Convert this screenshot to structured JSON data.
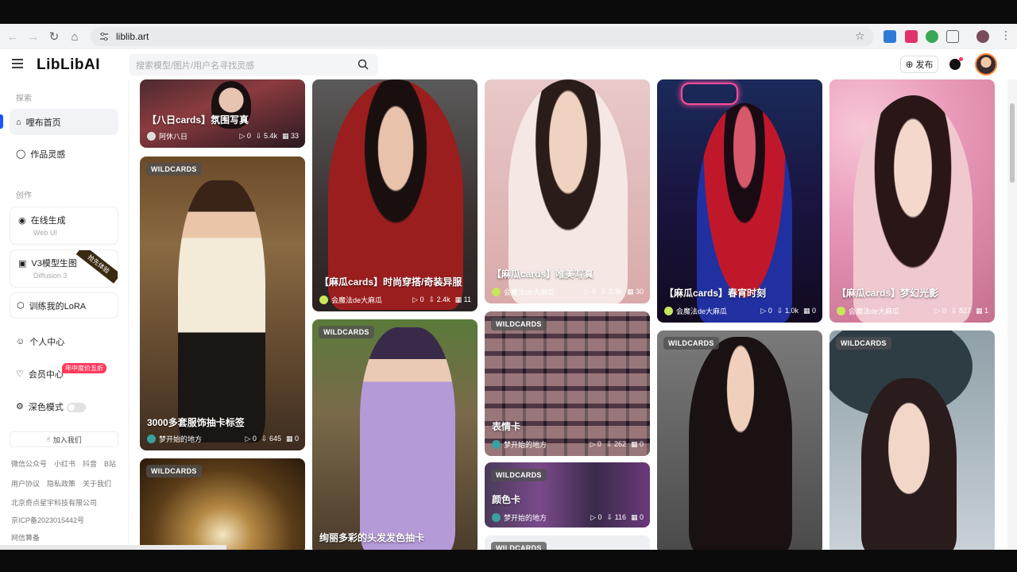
{
  "browser": {
    "url": "liblib.art"
  },
  "header": {
    "logo": "LibLibAI",
    "search_placeholder": "搜索模型/图片/用户名寻找灵感",
    "publish_label": "发布"
  },
  "sidebar": {
    "section_explore": "探索",
    "section_create": "创作",
    "home": "哩布首页",
    "inspiration": "作品灵感",
    "online_gen": {
      "title": "在线生成",
      "sub": "Web UI"
    },
    "v3_gen": {
      "title": "V3模型生图",
      "sub": "Diffusion 3",
      "ribbon": "抢先体验"
    },
    "train_lora": "训练我的LoRA",
    "personal": "个人中心",
    "member": "会员中心",
    "member_badge": "年中度价五折",
    "dark_mode": "深色模式",
    "join_us": "加入我们",
    "footer_links": [
      "微信公众号",
      "小红书",
      "抖音",
      "B站"
    ],
    "footer_links2": [
      "用户协议",
      "隐私政策",
      "关于我们"
    ],
    "company": "北京奇点星宇科技有限公司",
    "icp": "京ICP备2023015442号",
    "net": "网信算备"
  },
  "cards": [
    {
      "title": "【八日cards】氛围写真",
      "author": "阿休八日",
      "runs": "0",
      "downloads": "5.4k",
      "saves": "33"
    },
    {
      "tag": "WILDCARDS",
      "title": "3000多套服饰抽卡标签",
      "author": "梦开始的地方",
      "runs": "0",
      "downloads": "645",
      "saves": "0"
    },
    {
      "tag": "WILDCARDS"
    },
    {
      "title": "【麻瓜cards】时尚穿搭/奇装异服",
      "author": "会魔法de大麻瓜",
      "runs": "0",
      "downloads": "2.4k",
      "saves": "11"
    },
    {
      "tag": "WILDCARDS",
      "title": "绚丽多彩的头发发色抽卡"
    },
    {
      "title": "【麻瓜cards】唯美写真",
      "author": "会魔法de大麻瓜",
      "runs": "0",
      "downloads": "2.3k",
      "saves": "30"
    },
    {
      "tag": "WILDCARDS",
      "title": "表情卡",
      "author": "梦开始的地方",
      "runs": "0",
      "downloads": "262",
      "saves": "0"
    },
    {
      "tag": "WILDCARDS",
      "title": "颜色卡",
      "author": "梦开始的地方",
      "runs": "0",
      "downloads": "116",
      "saves": "0"
    },
    {
      "tag": "WILDCARDS"
    },
    {
      "title": "【麻瓜cards】春宵时刻",
      "author": "会魔法de大麻瓜",
      "runs": "0",
      "downloads": "1.0k",
      "saves": "0"
    },
    {
      "tag": "WILDCARDS"
    },
    {
      "title": "【麻瓜cards】梦幻光影",
      "author": "会魔法de大麻瓜",
      "runs": "0",
      "downloads": "827",
      "saves": "1"
    },
    {
      "tag": "WILDCARDS"
    }
  ]
}
